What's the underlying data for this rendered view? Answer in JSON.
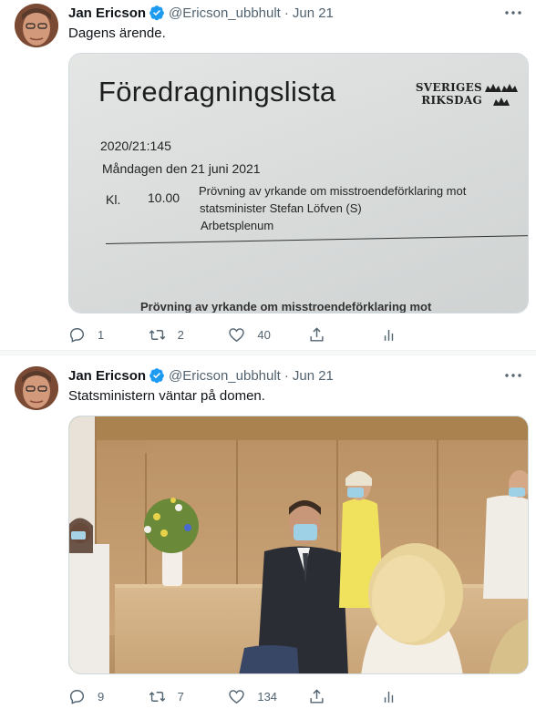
{
  "tweets": [
    {
      "author": "Jan Ericson",
      "handle": "@Ericson_ubbhult",
      "date": "Jun 21",
      "separator": "·",
      "text": "Dagens ärende.",
      "media": {
        "kind": "document",
        "title": "Föredragningslista",
        "brand_line1": "SVERIGES",
        "brand_line2": "RIKSDAG",
        "number": "2020/21:145",
        "day": "Måndagen den 21 juni 2021",
        "time_label": "Kl.",
        "time": "10.00",
        "item_line1": "Prövning av yrkande om misstroendeförklaring mot",
        "item_line2": "statsminister Stefan Löfven (S)",
        "item_line3": "Arbetsplenum",
        "cut_line": "Prövning av yrkande om misstroendeförklaring mot"
      },
      "stats": {
        "replies": "1",
        "retweets": "2",
        "likes": "40"
      }
    },
    {
      "author": "Jan Ericson",
      "handle": "@Ericson_ubbhult",
      "date": "Jun 21",
      "separator": "·",
      "text": "Statsministern väntar på domen.",
      "media": {
        "kind": "photo"
      },
      "stats": {
        "replies": "9",
        "retweets": "7",
        "likes": "134"
      }
    }
  ],
  "icons": {
    "verified": "verified-badge-icon",
    "more": "more-dots-icon",
    "reply": "reply-icon",
    "retweet": "retweet-icon",
    "like": "heart-icon",
    "share": "share-icon",
    "analytics": "analytics-icon"
  },
  "colors": {
    "verified": "#1d9bf0",
    "text": "#0f1419",
    "muted": "#536471",
    "border": "#cfd9de"
  }
}
